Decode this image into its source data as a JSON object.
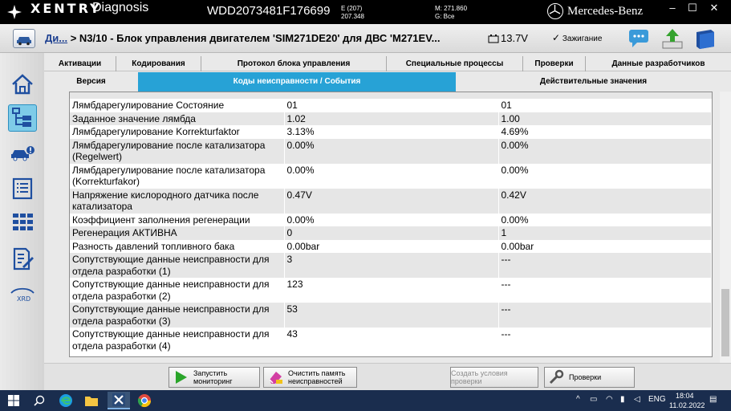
{
  "titlebar": {
    "brand": "XENTRY",
    "product": "Diagnosis",
    "vin": "WDD2073481F176699",
    "e_line1": "E (207)",
    "e_line2": "207.348",
    "m_line1": "M: 271.860",
    "m_line2": "G: Все",
    "maker": "Mercedes-Benz"
  },
  "header": {
    "crumb_link": "Ди...",
    "crumb_text": "> N3/10 - Блок управления двигателем 'SIM271DE20' для ДВС 'M271EV...",
    "battery": "13.7V",
    "ignition": "Зажигание"
  },
  "tabs_top": [
    "Активации",
    "Кодирования",
    "Протокол блока управления",
    "Специальные процессы",
    "Проверки",
    "Данные разработчиков"
  ],
  "tabs_bottom": [
    "Версия",
    "Коды неисправности / События",
    "Действительные значения"
  ],
  "table": {
    "rows": [
      {
        "name": "Лямбдарегулирование Состояние",
        "v1": "01",
        "v2": "01"
      },
      {
        "name": "Заданное значение лямбда",
        "v1": "1.02",
        "v2": "1.00"
      },
      {
        "name": "Лямбдарегулирование Korrekturfaktor",
        "v1": "3.13%",
        "v2": "4.69%"
      },
      {
        "name": "Лямбдарегулирование после катализатора (Regelwert)",
        "v1": "0.00%",
        "v2": "0.00%"
      },
      {
        "name": "Лямбдарегулирование после катализатора (Korrekturfakor)",
        "v1": "0.00%",
        "v2": "0.00%"
      },
      {
        "name": "Напряжение кислородного датчика после катализатора",
        "v1": "0.47V",
        "v2": "0.42V"
      },
      {
        "name": "Коэффициент заполнения регенерации",
        "v1": "0.00%",
        "v2": "0.00%"
      },
      {
        "name": "Регенерация АКТИВНА",
        "v1": "0",
        "v2": "1"
      },
      {
        "name": "Разность давлений топливного бака",
        "v1": "0.00bar",
        "v2": "0.00bar"
      },
      {
        "name": "Сопутствующие данные неисправности для отдела разработки (1)",
        "v1": "3",
        "v2": "---"
      },
      {
        "name": "Сопутствующие данные неисправности для отдела разработки (2)",
        "v1": "123",
        "v2": "---"
      },
      {
        "name": "Сопутствующие данные неисправности для отдела разработки (3)",
        "v1": "53",
        "v2": "---"
      },
      {
        "name": "Сопутствующие данные неисправности для отдела разработки (4)",
        "v1": "43",
        "v2": "---"
      }
    ]
  },
  "buttons": {
    "start_monitoring": "Запустить мониторинг",
    "clear_memory": "Очистить память неисправностей",
    "create_conditions": "Создать условия проверки",
    "checks": "Проверки"
  },
  "taskbar": {
    "lang": "ENG",
    "time": "18:04",
    "date": "11.02.2022"
  }
}
